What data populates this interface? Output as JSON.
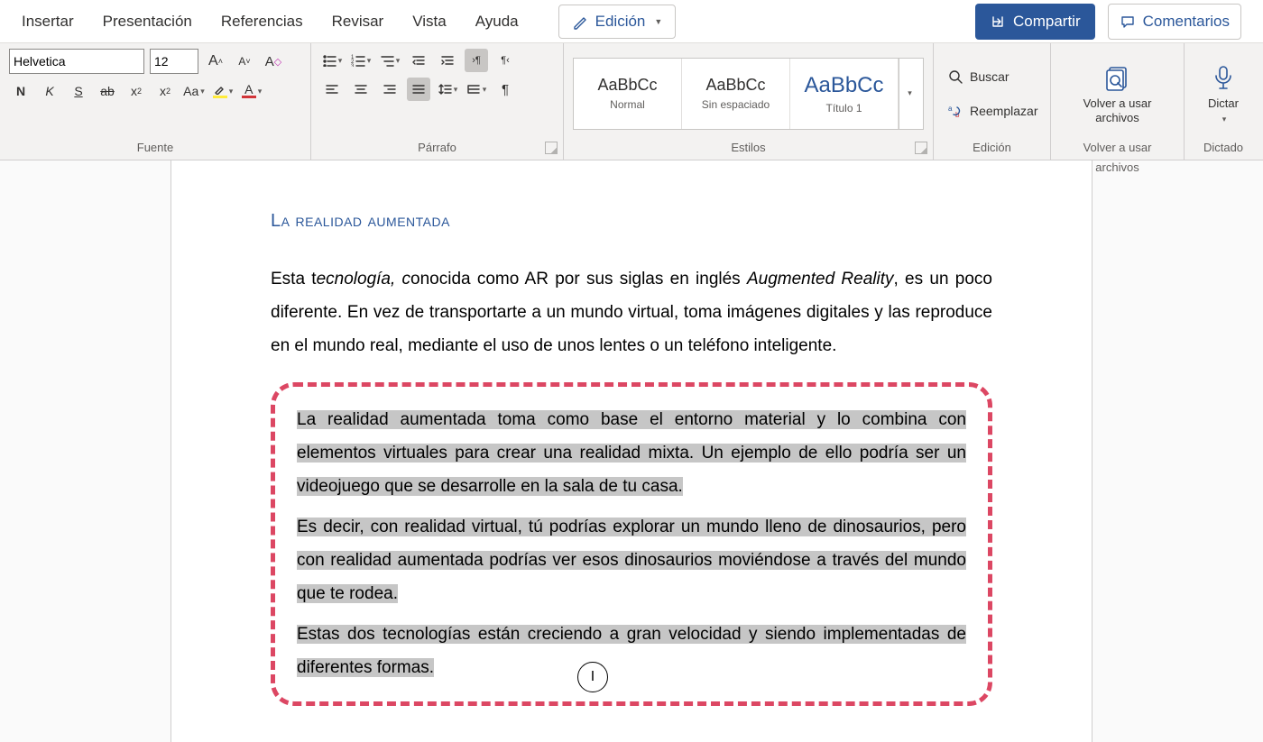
{
  "menu": {
    "tabs": [
      "Insertar",
      "Presentación",
      "Referencias",
      "Revisar",
      "Vista",
      "Ayuda"
    ],
    "edit_mode": "Edición",
    "share": "Compartir",
    "comments": "Comentarios"
  },
  "ribbon": {
    "font": {
      "name_value": "Helvetica",
      "size_value": "12",
      "group_label": "Fuente"
    },
    "paragraph": {
      "group_label": "Párrafo"
    },
    "styles": {
      "group_label": "Estilos",
      "sample": "AaBbCc",
      "items": [
        {
          "name": "Normal"
        },
        {
          "name": "Sin espaciado"
        },
        {
          "name": "Título 1"
        }
      ]
    },
    "editing": {
      "group_label": "Edición",
      "find": "Buscar",
      "replace": "Reemplazar"
    },
    "reuse": {
      "label": "Volver a usar archivos",
      "group_label": "Volver a usar archivos"
    },
    "dictate": {
      "label": "Dictar",
      "group_label": "Dictado"
    }
  },
  "document": {
    "heading": "La realidad aumentada",
    "p1_a": "Esta t",
    "p1_b": "ecnología, c",
    "p1_c": "onocida como AR por sus siglas en inglés ",
    "p1_d": "Augmented Reality",
    "p1_e": ", es un poco diferente. En vez de transportarte a un mundo virtual, toma imágenes digitales y las reproduce en el mundo real, mediante el uso de unos lentes o un teléfono inteligente.",
    "p2": "La realidad aumentada toma como base el entorno material y lo combina con elementos virtuales para crear una realidad mixta. Un ejemplo de ello podría ser un videojuego que se desarrolle en la sala de tu casa.",
    "p3": "Es decir, con realidad virtual, tú podrías explorar un mundo lleno de dinosaurios, pero con realidad aumentada podrías ver esos dinosaurios moviéndose a través del mundo que te rodea.",
    "p4": "Estas dos tecnologías están creciendo a gran velocidad y siendo implementadas de diferentes formas."
  }
}
